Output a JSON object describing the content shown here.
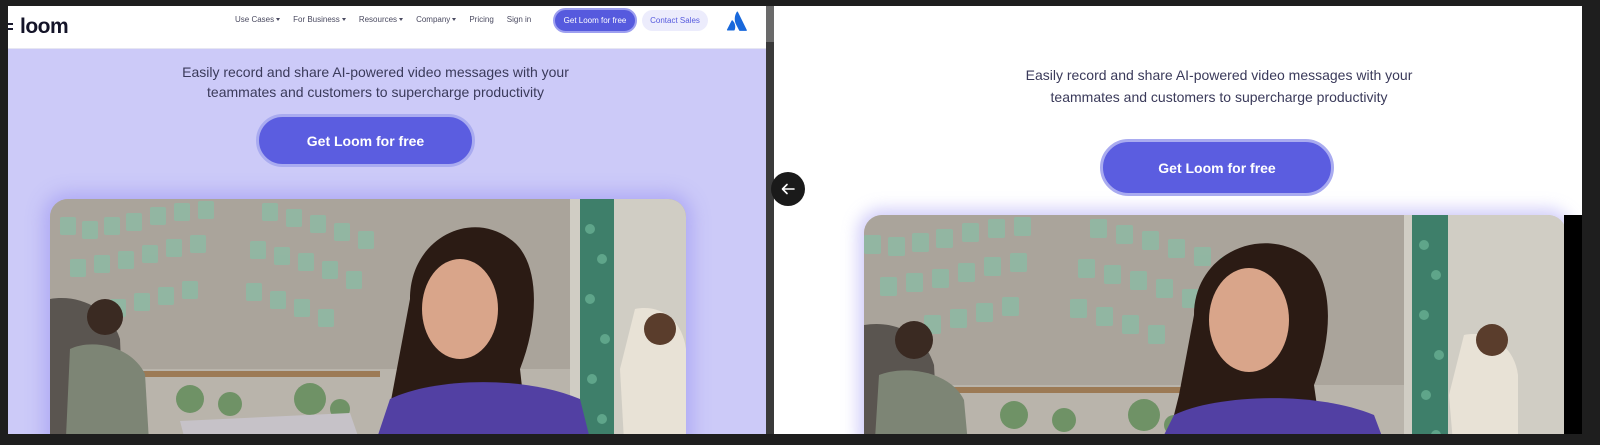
{
  "left": {
    "brand": "loom",
    "nav": [
      {
        "label": "Use Cases",
        "dropdown": true
      },
      {
        "label": "For Business",
        "dropdown": true
      },
      {
        "label": "Resources",
        "dropdown": true
      },
      {
        "label": "Company",
        "dropdown": true
      },
      {
        "label": "Pricing",
        "dropdown": false
      },
      {
        "label": "Sign in",
        "dropdown": false
      }
    ],
    "nav_primary": "Get Loom for free",
    "nav_secondary": "Contact Sales",
    "hero_line1": "Easily record and share AI-powered video messages with your",
    "hero_line2": "teammates and customers to supercharge productivity",
    "cta": "Get Loom for free"
  },
  "right": {
    "hero_line1": "Easily record and share AI-powered video messages with your",
    "hero_line2": "teammates and customers to supercharge productivity",
    "cta": "Get Loom for free"
  },
  "icons": {
    "brand_mark": "loom-menu-icon",
    "atlassian": "atlassian-logo-icon",
    "back": "arrow-left-icon"
  },
  "colors": {
    "hero_bg": "#cccaf8",
    "primary": "#5b5de0",
    "primary_border": "#a9abf0",
    "secondary_bg": "#ececfc",
    "atlassian_blue": "#1868db"
  }
}
